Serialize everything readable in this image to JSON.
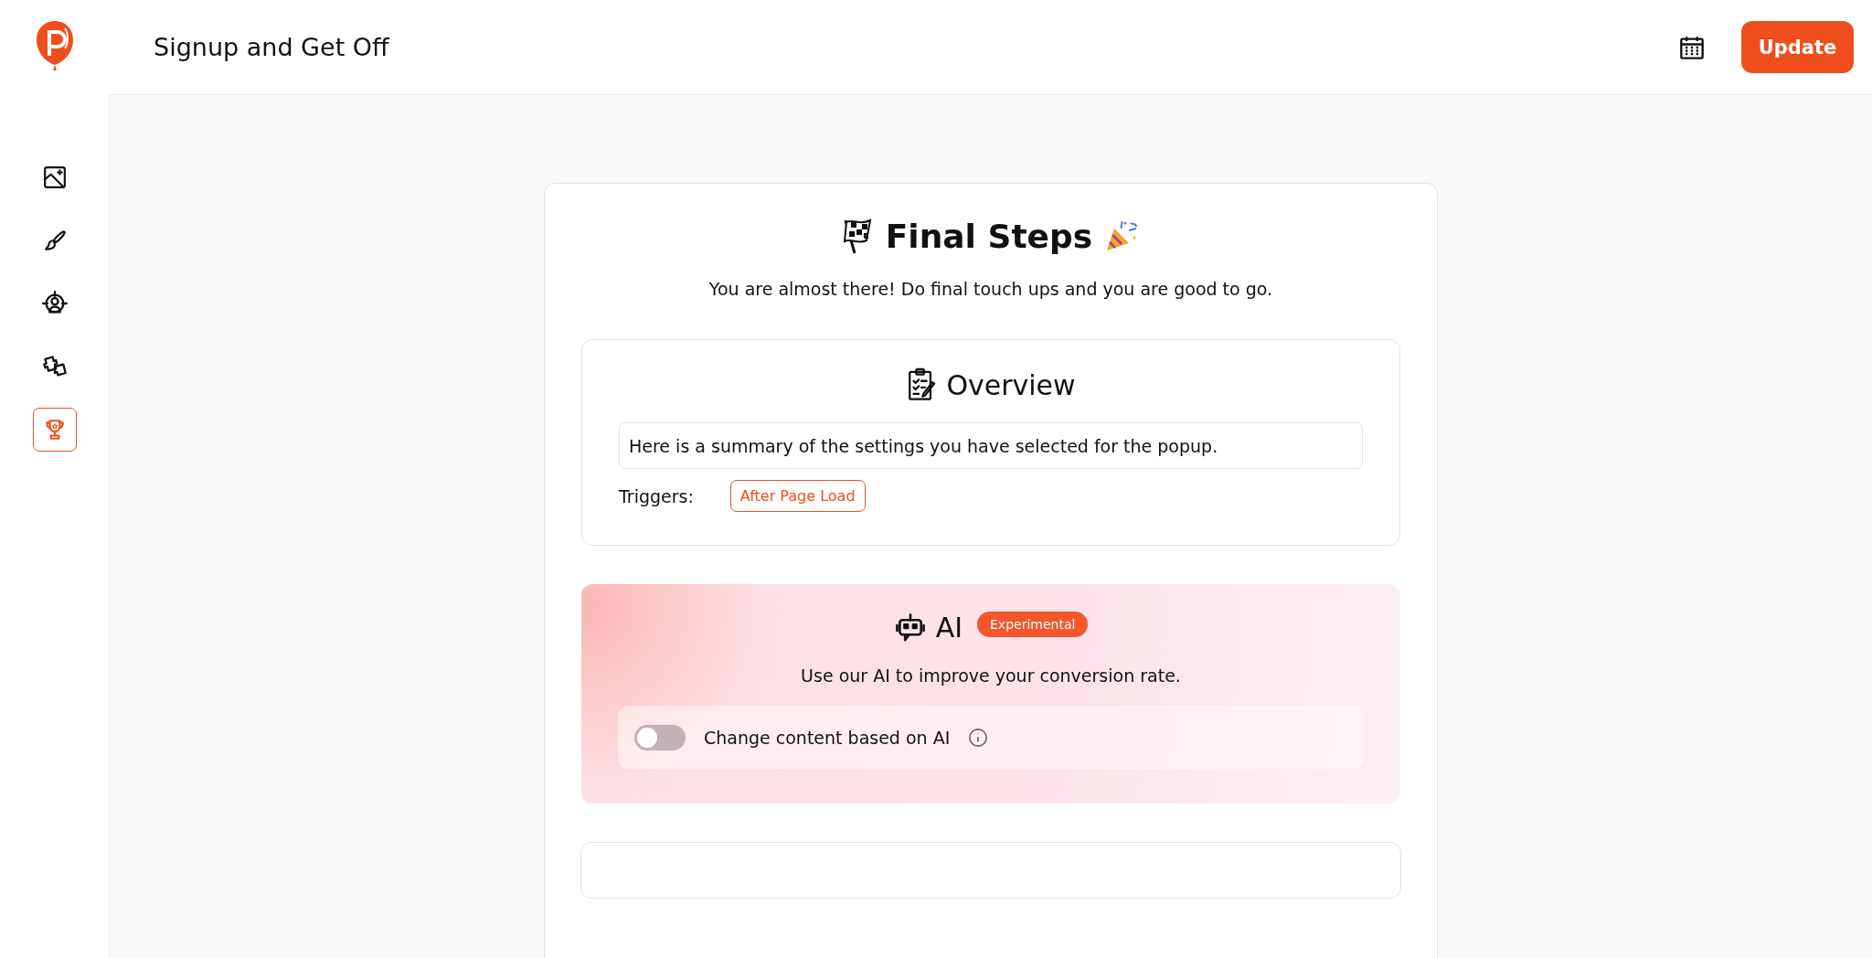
{
  "header": {
    "title": "Signup and Get Off",
    "action": "Update"
  },
  "sidebar": {
    "items": [
      {
        "kind": "image",
        "selected": false
      },
      {
        "kind": "brush",
        "selected": false
      },
      {
        "kind": "target",
        "selected": false
      },
      {
        "kind": "puzzle",
        "selected": false
      },
      {
        "kind": "trophy",
        "selected": true
      }
    ]
  },
  "page": {
    "title": "Final Steps",
    "subtitle": "You are almost there! Do final touch ups and you are good to go."
  },
  "overview": {
    "title": "Overview",
    "summary": "Here is a summary of the settings you have selected for the popup.",
    "triggers_label": "Triggers:",
    "triggers": [
      "After Page Load"
    ]
  },
  "ai": {
    "title": "AI",
    "badge": "Experimental",
    "description": "Use our AI to improve your conversion rate.",
    "toggle": {
      "label": "Change content based on AI",
      "on": false
    }
  }
}
